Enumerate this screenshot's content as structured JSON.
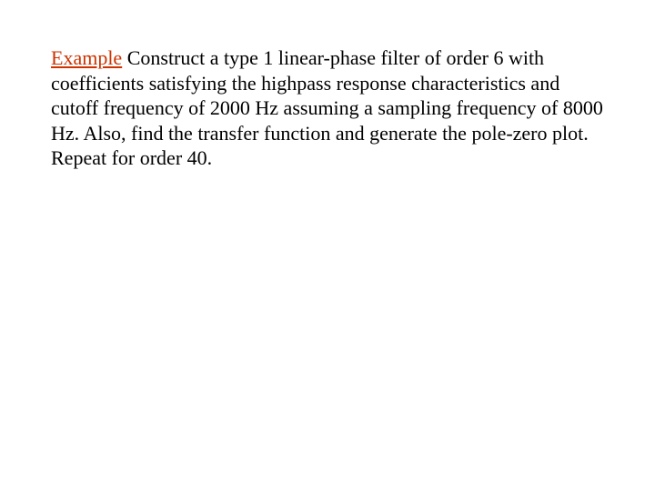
{
  "slide": {
    "label": "Example",
    "body": "  Construct a type 1 linear-phase filter of order 6 with coefficients satisfying the highpass response characteristics and cutoff frequency of 2000 Hz assuming a sampling frequency of 8000 Hz. Also, find the transfer function and generate the pole-zero plot.  Repeat for order 40."
  }
}
